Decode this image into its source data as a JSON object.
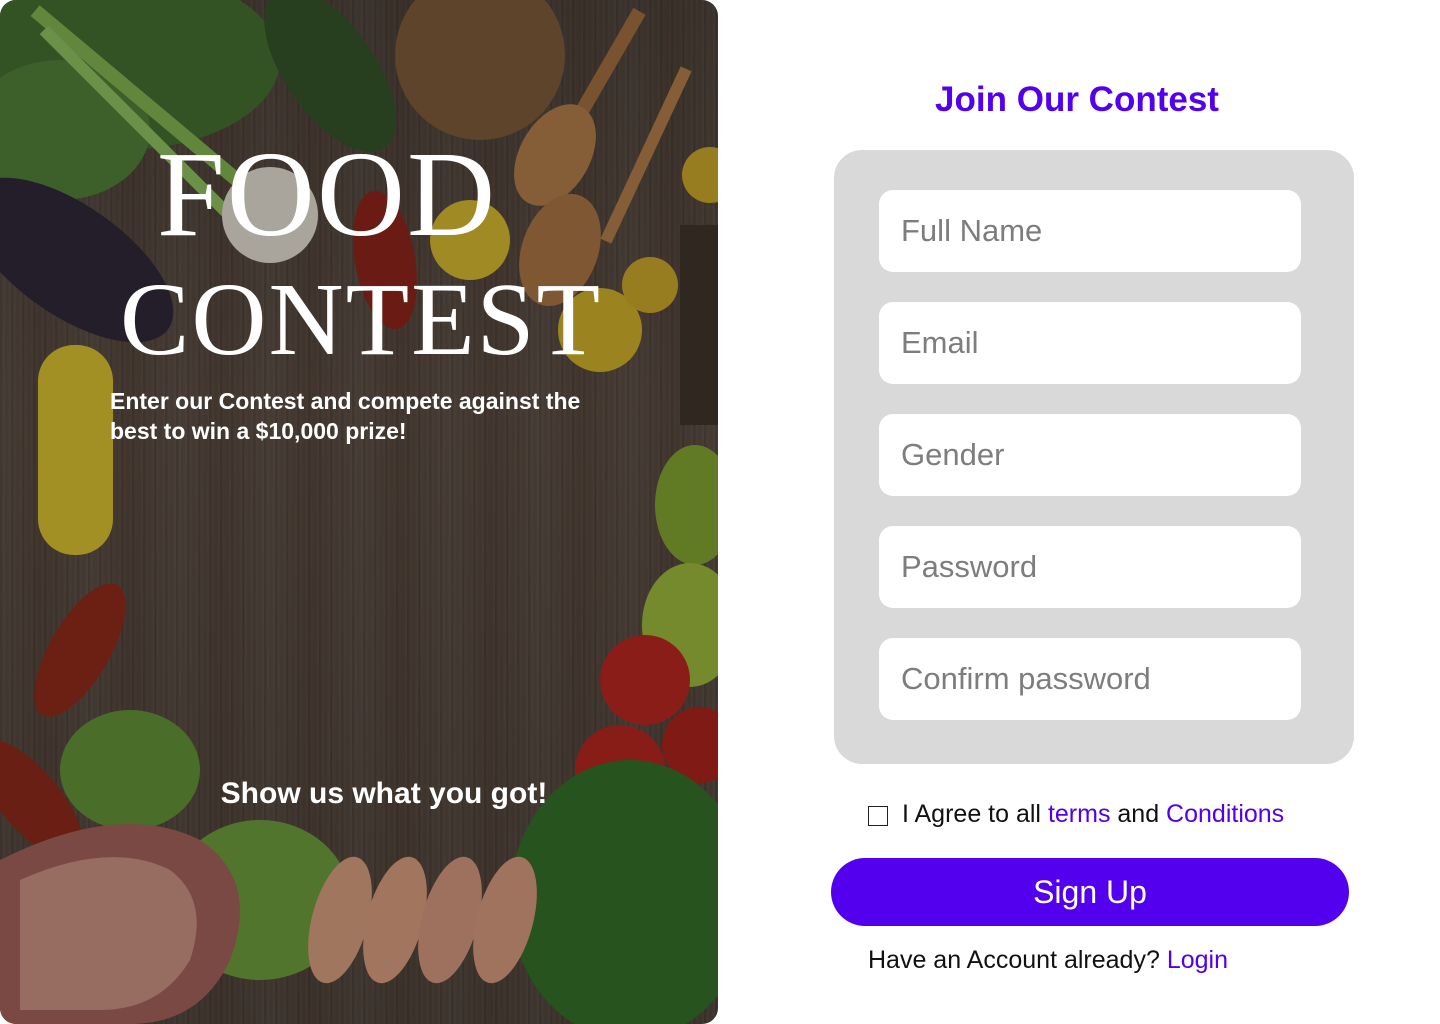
{
  "hero": {
    "title_line1": "FOOD",
    "title_line2": "CONTEST",
    "subtitle": "Enter our Contest and compete against the best to win a $10,000 prize!",
    "cta": "Show us what you got!"
  },
  "form": {
    "title": "Join Our Contest",
    "fields": [
      {
        "placeholder": "Full Name",
        "value": ""
      },
      {
        "placeholder": "Email",
        "value": ""
      },
      {
        "placeholder": "Gender",
        "value": ""
      },
      {
        "placeholder": "Password",
        "value": ""
      },
      {
        "placeholder": "Confirm password",
        "value": ""
      }
    ],
    "agree_prefix": "I Agree to all ",
    "terms_link": "terms",
    "agree_and": " and ",
    "conditions_link": "Conditions",
    "signup_label": "Sign Up",
    "have_account": "Have an Account already? ",
    "login_link": "Login"
  },
  "colors": {
    "accent": "#5300ef",
    "card_bg": "#d9d9d9"
  }
}
